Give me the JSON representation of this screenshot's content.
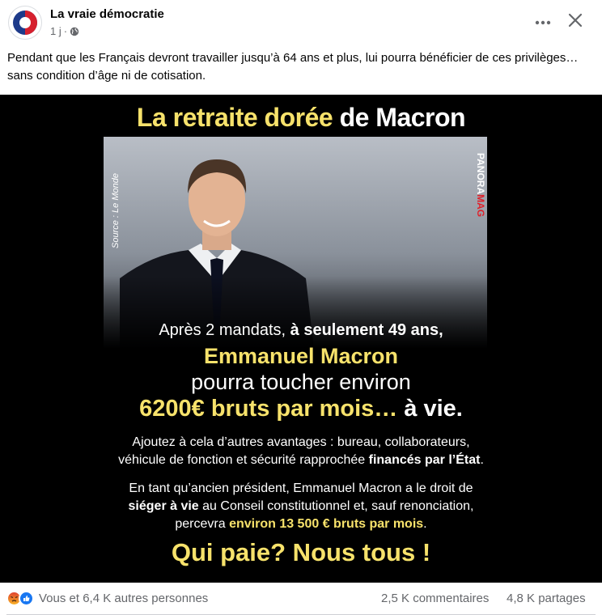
{
  "header": {
    "page_name": "La vraie démocratie",
    "time": "1 j",
    "separator": "·"
  },
  "post": {
    "text": "Pendant que les Français devront travailler jusqu’à 64 ans et plus, lui pourra bénéficier de ces privilèges… sans condition d’âge ni de cotisation."
  },
  "image": {
    "title_gold": "La retraite dorée",
    "title_white": " de Macron",
    "source_label": "Source : Le Monde",
    "brand_part1": "PANORA",
    "brand_part2": "MAG",
    "line1_a": "Après 2 mandats, ",
    "line1_b": "à seulement 49 ans,",
    "line2": "Emmanuel Macron",
    "line3": "pourra toucher environ",
    "line4_a": "6200€ bruts par mois… ",
    "line4_b": "à vie.",
    "line5_a": "Ajoutez à cela d’autres avantages : bureau, collaborateurs,",
    "line5_b": "véhicule de fonction et sécurité rapprochée ",
    "line5_c": "financés par l’État",
    "line5_d": ".",
    "line6_a": "En tant qu’ancien président, Emmanuel Macron a le droit de",
    "line6_b": "siéger à vie",
    "line6_c": " au Conseil constitutionnel et, sauf renonciation,",
    "line6_d": "percevra ",
    "line6_e": "environ 13 500 € bruts par mois",
    "line6_f": ".",
    "line7": "Qui paie? Nous tous !"
  },
  "footer": {
    "reactions_text": "Vous et 6,4 K autres personnes",
    "comments": "2,5 K commentaires",
    "shares": "4,8 K partages"
  },
  "icons": {
    "avatar": "logo-icon",
    "globe": "globe-icon",
    "more": "more-icon",
    "close": "close-icon",
    "reaction1": "angry-reaction-icon",
    "reaction2": "like-reaction-icon"
  },
  "colors": {
    "gold": "#f7e26b",
    "meta_gray": "#65676b",
    "like_blue": "#1877f2",
    "angry_orange": "#e9710f"
  }
}
